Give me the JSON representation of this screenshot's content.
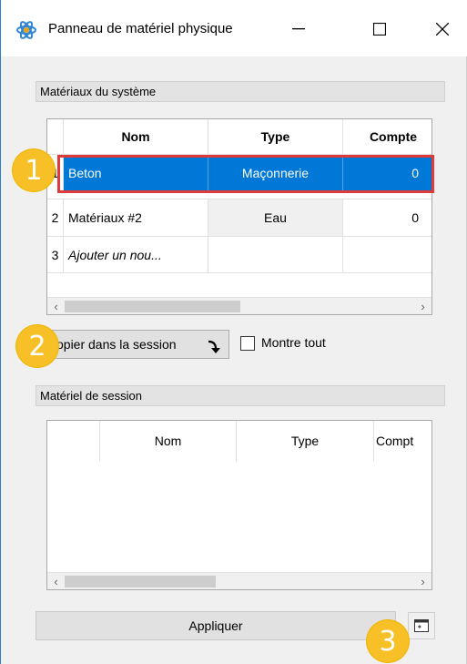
{
  "window": {
    "title": "Panneau de matériel physique",
    "icon": "atom-icon",
    "accent": "#0078d7"
  },
  "system_materials": {
    "header": "Matériaux du système",
    "columns": [
      "Nom",
      "Type",
      "Compte"
    ],
    "rows": [
      {
        "num": "1",
        "name": "Beton",
        "type": "Maçonnerie",
        "count": "0",
        "selected": true
      },
      {
        "num": "2",
        "name": "Matériaux #2",
        "type": "Eau",
        "count": "0",
        "selected": false
      },
      {
        "num": "3",
        "name": "Ajouter un nou...",
        "type": "",
        "count": "",
        "selected": false
      }
    ]
  },
  "actions": {
    "copy_label": "opier dans la session",
    "show_all_label": "Montre tout",
    "show_all_checked": false
  },
  "session_materials": {
    "header": "Matériel de session",
    "columns": [
      "Nom",
      "Type",
      "Compt"
    ],
    "rows": []
  },
  "footer": {
    "apply_label": "Appliquer"
  },
  "callouts": [
    "1",
    "2",
    "3"
  ],
  "colors": {
    "selection": "#0078d7",
    "highlight": "#e03b3b",
    "badge": "#f6c026"
  }
}
